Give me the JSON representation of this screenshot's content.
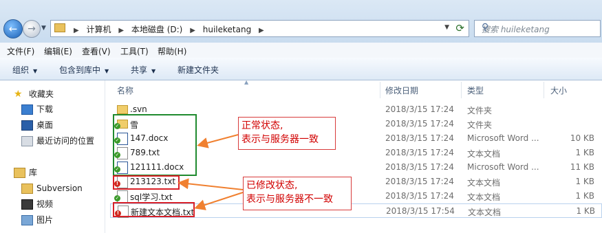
{
  "address": {
    "crumbs": [
      "计算机",
      "本地磁盘 (D:)",
      "huileketang"
    ]
  },
  "search": {
    "placeholder": "搜索 huileketang"
  },
  "menu": [
    "文件(F)",
    "编辑(E)",
    "查看(V)",
    "工具(T)",
    "帮助(H)"
  ],
  "commands": [
    {
      "label": "组织",
      "dropdown": true
    },
    {
      "label": "包含到库中",
      "dropdown": true
    },
    {
      "label": "共享",
      "dropdown": true
    },
    {
      "label": "新建文件夹",
      "dropdown": false
    }
  ],
  "nav": {
    "favorites": "收藏夹",
    "fav_items": [
      "下载",
      "桌面",
      "最近访问的位置"
    ],
    "libraries": "库",
    "lib_items": [
      "Subversion",
      "视频",
      "图片"
    ]
  },
  "columns": {
    "name": "名称",
    "date": "修改日期",
    "type": "类型",
    "size": "大小"
  },
  "files": [
    {
      "name": ".svn",
      "date": "2018/3/15 17:24",
      "type": "文件夹",
      "size": "",
      "icon": "folder",
      "status": "none"
    },
    {
      "name": "雪",
      "date": "2018/3/15 17:24",
      "type": "文件夹",
      "size": "",
      "icon": "folder",
      "status": "normal"
    },
    {
      "name": "147.docx",
      "date": "2018/3/15 17:24",
      "type": "Microsoft Word ...",
      "size": "10 KB",
      "icon": "word",
      "status": "normal"
    },
    {
      "name": "789.txt",
      "date": "2018/3/15 17:24",
      "type": "文本文档",
      "size": "1 KB",
      "icon": "doc",
      "status": "normal"
    },
    {
      "name": "121111.docx",
      "date": "2018/3/15 17:24",
      "type": "Microsoft Word ...",
      "size": "11 KB",
      "icon": "word",
      "status": "normal"
    },
    {
      "name": "213123.txt",
      "date": "2018/3/15 17:24",
      "type": "文本文档",
      "size": "1 KB",
      "icon": "doc",
      "status": "modified"
    },
    {
      "name": "sql学习.txt",
      "date": "2018/3/15 17:24",
      "type": "文本文档",
      "size": "1 KB",
      "icon": "doc",
      "status": "normal"
    },
    {
      "name": "新建文本文档.txt",
      "date": "2018/3/15 17:54",
      "type": "文本文档",
      "size": "1 KB",
      "icon": "doc",
      "status": "modified"
    }
  ],
  "annotations": {
    "normal": [
      "正常状态,",
      "表示与服务器一致"
    ],
    "modified": [
      "已修改状态,",
      "表示与服务器不一致"
    ]
  },
  "colors": {
    "annotation_text": "#d10000",
    "normal_box": "#1f8a2e",
    "modified_box": "#d92027",
    "arrow": "#f08030"
  }
}
